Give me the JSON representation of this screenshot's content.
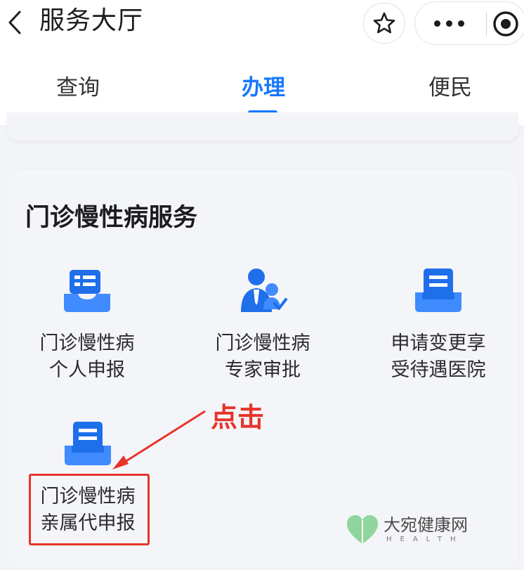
{
  "header": {
    "title": "服务大厅",
    "icons": {
      "back": "chevron-left-icon",
      "favorite": "star-icon",
      "more": "more-icon",
      "close": "target-icon"
    }
  },
  "tabs": [
    {
      "label": "查询",
      "active": false
    },
    {
      "label": "办理",
      "active": true
    },
    {
      "label": "便民",
      "active": false
    }
  ],
  "section": {
    "title": "门诊慢性病服务",
    "items": [
      {
        "line1": "门诊慢性病",
        "line2": "个人申报",
        "icon": "inbox-list-icon"
      },
      {
        "line1": "门诊慢性病",
        "line2": "专家审批",
        "icon": "expert-approve-icon"
      },
      {
        "line1": "申请变更享",
        "line2": "受待遇医院",
        "icon": "document-tray-icon"
      },
      {
        "line1": "门诊慢性病",
        "line2": "亲属代申报",
        "icon": "document-tray-icon"
      }
    ]
  },
  "annotation": {
    "label": "点击"
  },
  "watermark": {
    "name": "大宛健康网",
    "sub": "HEALTH"
  },
  "colors": {
    "accent": "#1677ff",
    "annotation": "#e8332a"
  }
}
